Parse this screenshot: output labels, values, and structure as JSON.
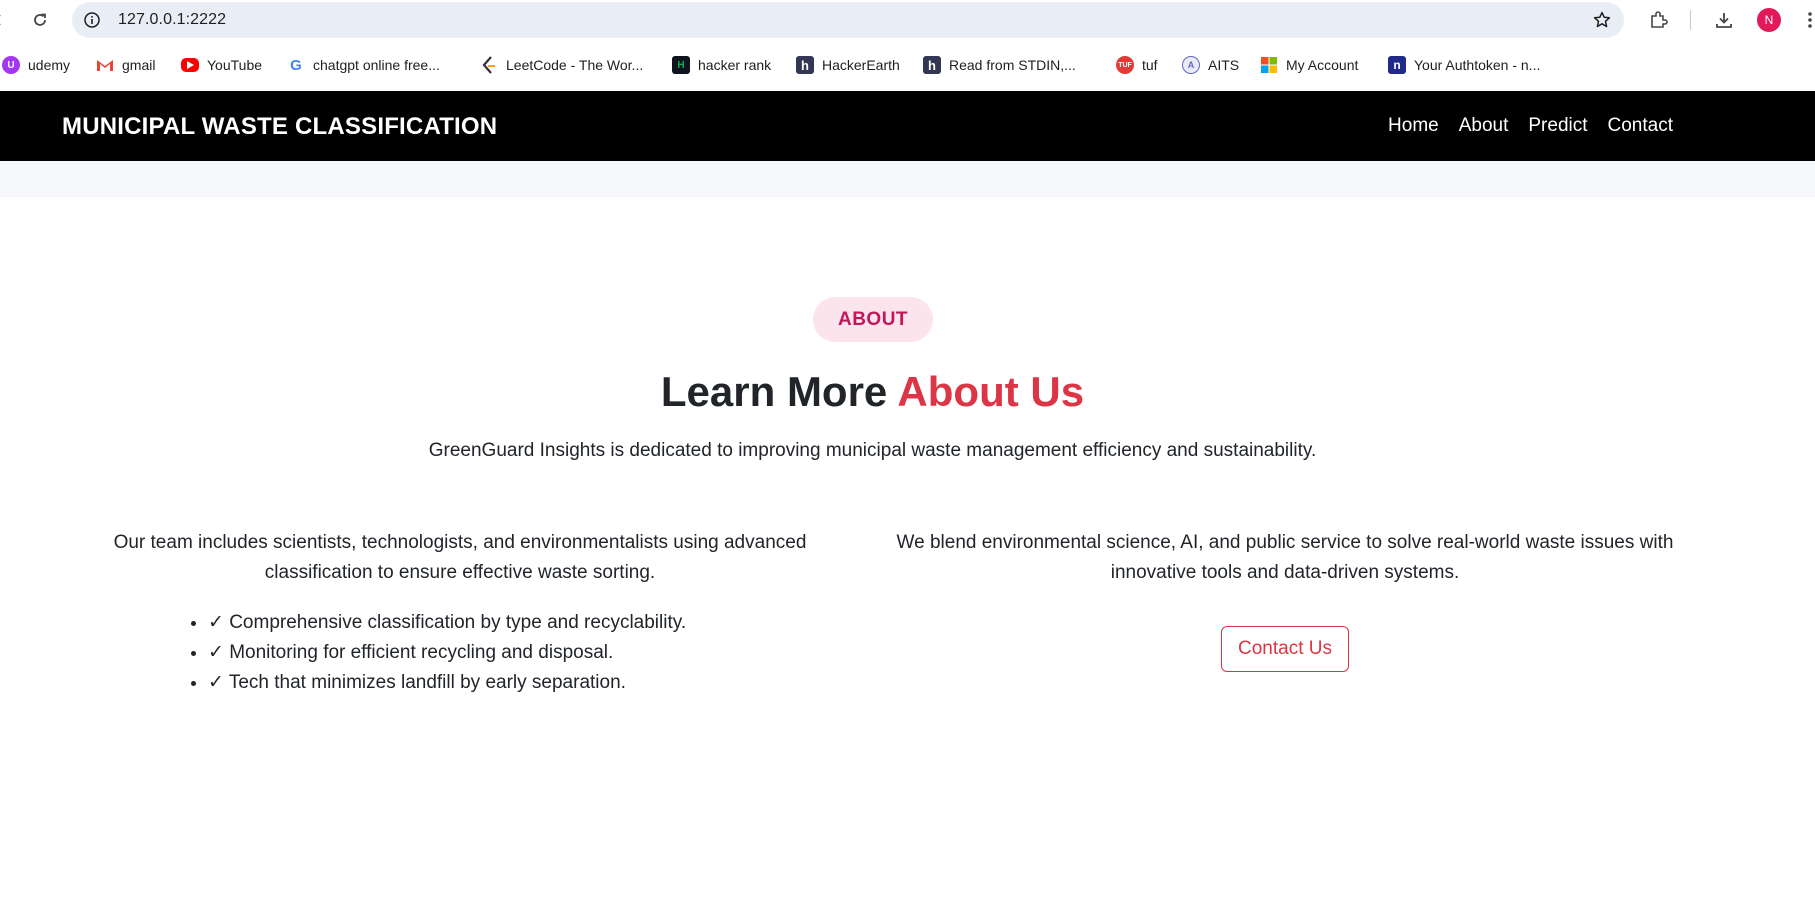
{
  "browser": {
    "url": "127.0.0.1:2222",
    "avatar_initial": "N",
    "avatar_color": "#e2195b",
    "bookmarks": [
      {
        "label": "udemy",
        "icon": "udemy-icon",
        "color": "#a435f0"
      },
      {
        "label": "gmail",
        "icon": "gmail-icon",
        "color": "#ea4335"
      },
      {
        "label": "YouTube",
        "icon": "youtube-icon",
        "color": "#ff0000"
      },
      {
        "label": "chatgpt online free...",
        "icon": "google-icon",
        "color": "#4285f4"
      },
      {
        "label": "LeetCode - The Wor...",
        "icon": "leetcode-icon",
        "color": "#ffa116"
      },
      {
        "label": "hacker rank",
        "icon": "hackerrank-icon",
        "color": "#1ba94c"
      },
      {
        "label": "HackerEarth",
        "icon": "hackerearth-icon",
        "color": "#323754"
      },
      {
        "label": "Read from STDIN,...",
        "icon": "hackerearth-icon",
        "color": "#323754"
      },
      {
        "label": "tuf",
        "icon": "tuf-icon",
        "color": "#e53935"
      },
      {
        "label": "AITS",
        "icon": "aits-icon",
        "color": "#5c6bc0"
      },
      {
        "label": "My Account",
        "icon": "microsoft-icon",
        "color": "#00a4ef"
      },
      {
        "label": "Your Authtoken - n...",
        "icon": "ngrok-icon",
        "color": "#1f2a8a"
      }
    ]
  },
  "navbar": {
    "brand": "MUNICIPAL WASTE CLASSIFICATION",
    "links": [
      "Home",
      "About",
      "Predict",
      "Contact"
    ]
  },
  "about": {
    "pill": "ABOUT",
    "heading_plain": "Learn More",
    "heading_accent": "About Us",
    "accent_color": "#dc3545",
    "lead": "GreenGuard Insights is dedicated to improving municipal waste management efficiency and sustainability.",
    "left_text": "Our team includes scientists, technologists, and environmentalists using advanced classification to ensure effective waste sorting.",
    "checklist": [
      "✓ Comprehensive classification by type and recyclability.",
      "✓ Monitoring for efficient recycling and disposal.",
      "✓ Tech that minimizes landfill by early separation."
    ],
    "right_text": "We blend environmental science, AI, and public service to solve real-world waste issues with innovative tools and data-driven systems.",
    "contact_button": "Contact Us"
  }
}
